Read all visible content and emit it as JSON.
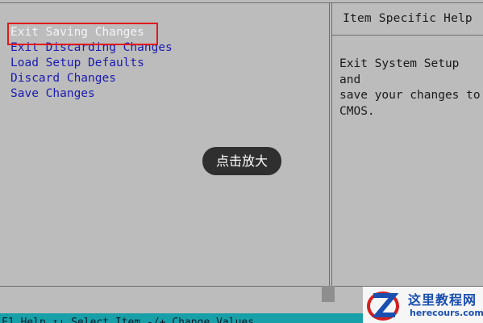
{
  "menu": {
    "items": [
      "Exit Saving Changes",
      "Exit Discarding Changes",
      "Load Setup Defaults",
      "Discard Changes",
      "Save Changes"
    ],
    "selected_index": 0
  },
  "help": {
    "title": "Item Specific Help",
    "text": "Exit System Setup and\nsave your changes to\nCMOS."
  },
  "overlay": {
    "zoom_label": "点击放大"
  },
  "status_bar": {
    "text": "F1  Help  ↑↓ Select Item  -/+  Change Values"
  },
  "watermark": {
    "title": "这里教程网",
    "url": "herecours.com"
  },
  "colors": {
    "background": "#bcbcbc",
    "menu_text": "#1b1bb0",
    "selected_text": "#f4f4f4",
    "selection_border": "#e01a1a",
    "status_bar": "#18a0a8",
    "watermark_blue": "#1a4fb0",
    "watermark_red": "#d42020"
  }
}
